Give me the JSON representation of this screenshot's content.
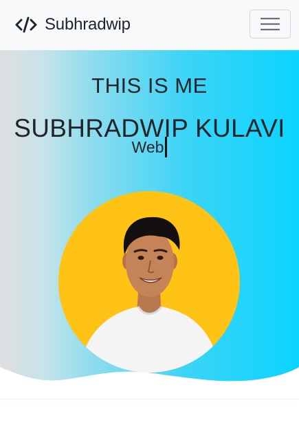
{
  "navbar": {
    "brand_name": "Subhradwip",
    "brand_icon": "code-icon",
    "toggle_icon": "hamburger-menu-icon"
  },
  "hero": {
    "kicker": "THIS IS ME",
    "name": "SUBHRADWIP KULAVI",
    "typed_text": "Web",
    "avatar": "profile-photo"
  },
  "colors": {
    "navbar_bg": "#f8f9fa",
    "gradient_start": "#dfdfdf",
    "gradient_end": "#0ad4ff",
    "avatar_bg": "#fec315",
    "text": "#212529"
  }
}
